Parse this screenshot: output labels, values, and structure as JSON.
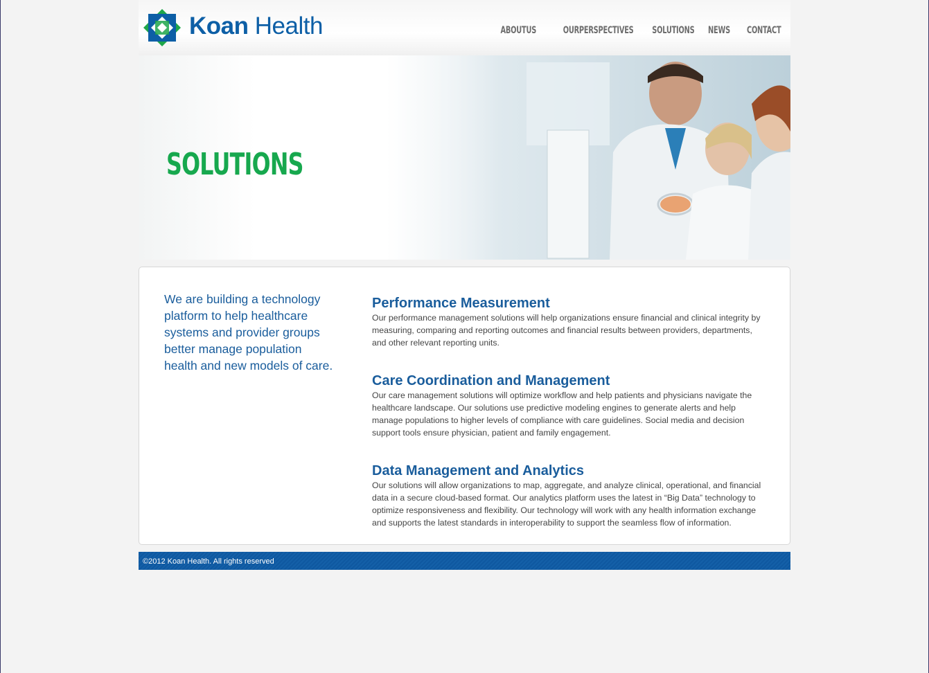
{
  "header": {
    "brand_bold": "Koan",
    "brand_light": "Health",
    "nav": [
      "ABOUTUS",
      "OURPERSPECTIVES",
      "SOLUTIONS",
      "NEWS",
      "CONTACT"
    ]
  },
  "hero": {
    "title": "SOLUTIONS"
  },
  "intro": "We are building a technology platform to help healthcare systems and provider groups better manage population health and new models of care.",
  "sections": [
    {
      "title": "Performance Measurement",
      "body": "Our performance management solutions will help organizations ensure financial and clinical integrity by measuring, comparing and reporting outcomes and financial results between providers, departments, and other relevant reporting units."
    },
    {
      "title": "Care Coordination and Management",
      "body": "Our care management solutions will optimize workflow and help patients and physicians navigate the healthcare landscape. Our solutions use predictive modeling engines to generate alerts and help manage populations to higher levels of compliance with care guidelines. Social media and decision support tools ensure physician, patient and family engagement."
    },
    {
      "title": "Data Management and Analytics",
      "body": "Our solutions will allow organizations to map, aggregate, and analyze clinical, operational, and financial data in a secure cloud-based format. Our analytics platform uses the latest in “Big Data” technology to optimize responsiveness and flexibility. Our technology will work with any health information exchange and supports the latest standards in interoperability to support the seamless flow of information."
    }
  ],
  "footer": {
    "copyright": "©2012 Koan Health. All rights reserved"
  },
  "colors": {
    "brand_blue": "#1a5d9c",
    "accent_green": "#17a84e",
    "footer_blue": "#1460a8"
  }
}
